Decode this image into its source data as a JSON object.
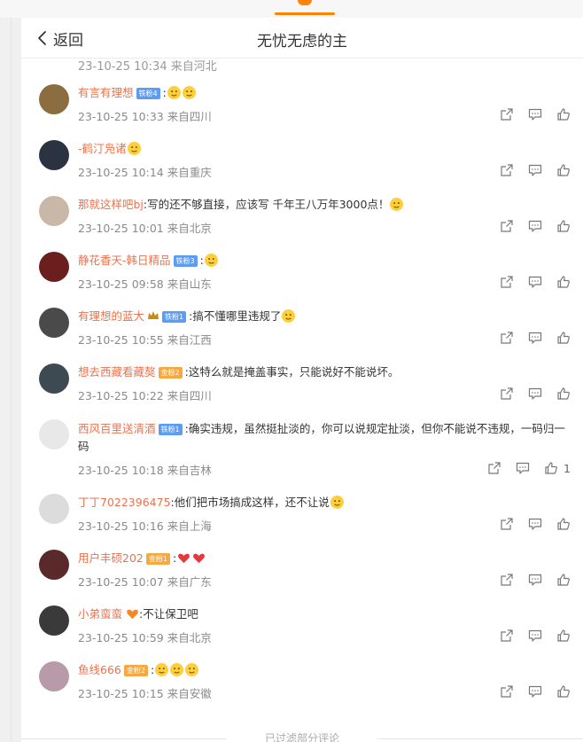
{
  "header": {
    "back_label": "返回",
    "title": "无忧无虑的主"
  },
  "ghost_row": {
    "text": "23-10-25 10:34 来自河北"
  },
  "comments": [
    {
      "nick": "有言有理想",
      "badge": "铁粉4",
      "badge_color": "blue",
      "text": ":",
      "emojis": [
        "cry",
        "cry"
      ],
      "meta": "23-10-25 10:33 来自四川",
      "likes": ""
    },
    {
      "nick": "-鹤汀凫诸",
      "badge": "",
      "text": "",
      "emojis": [
        "laugh"
      ],
      "meta": "23-10-25 10:14 来自重庆",
      "likes": ""
    },
    {
      "nick": "那就这样吧bj",
      "badge": "",
      "text": ":写的还不够直接，应该写 千年王八万年3000点！",
      "emojis": [
        "tongue"
      ],
      "meta": "23-10-25 10:01 来自北京",
      "likes": ""
    },
    {
      "nick": "静花香天-韩日精品",
      "badge": "铁粉3",
      "badge_color": "blue",
      "text": ":",
      "emojis": [
        "shush"
      ],
      "meta": "23-10-25 09:58 来自山东",
      "likes": ""
    },
    {
      "nick": "有理想的蓝大",
      "badge": "铁粉1",
      "badge_color": "blue",
      "crown": true,
      "text": ":搞不懂哪里违规了",
      "emojis": [
        "think"
      ],
      "meta": "23-10-25 10:55 来自江西",
      "likes": ""
    },
    {
      "nick": "想去西藏看藏獒",
      "badge": "金粉2",
      "badge_color": "gold",
      "text": ":这特么就是掩盖事实，只能说好不能说坏。",
      "emojis": [],
      "meta": "23-10-25 10:22 来自四川",
      "likes": ""
    },
    {
      "nick": "西风百里送清酒",
      "badge": "铁粉1",
      "badge_color": "blue",
      "text": ":确实违规，虽然挺扯淡的，你可以说规定扯淡，但你不能说不违规，一码归一码",
      "emojis": [],
      "meta": "23-10-25 10:18 来自吉林",
      "likes": "1",
      "tall": true
    },
    {
      "nick": "丁丁7022396475",
      "badge": "",
      "text": ":他们把市场搞成这样，还不让说",
      "emojis": [
        "cry2"
      ],
      "meta": "23-10-25 10:16 来自上海",
      "likes": ""
    },
    {
      "nick": "用户丰硕202",
      "badge": "金粉1",
      "badge_color": "gold",
      "text": ":",
      "emojis": [
        "heart",
        "heart"
      ],
      "meta": "23-10-25 10:07 来自广东",
      "likes": ""
    },
    {
      "nick": "小弟蛮蛮",
      "badge": "",
      "fan_icon": true,
      "text": ":不让保卫吧",
      "emojis": [],
      "meta": "23-10-25 10:59 来自北京",
      "likes": ""
    },
    {
      "nick": "鱼线666",
      "badge": "金粉2",
      "badge_color": "gold",
      "text": ":",
      "emojis": [
        "laugh",
        "laugh",
        "laugh"
      ],
      "meta": "23-10-25 10:15 来自安徽",
      "likes": ""
    }
  ],
  "footer": {
    "note": "已过滤部分评论"
  },
  "colors": {
    "accent": "#ff8200",
    "nick": "#eb7350",
    "meta": "#8a8a8a"
  },
  "icons": {
    "back": "chevron-left-icon",
    "share": "share-icon",
    "reply": "comment-icon",
    "like": "thumbs-up-icon"
  }
}
